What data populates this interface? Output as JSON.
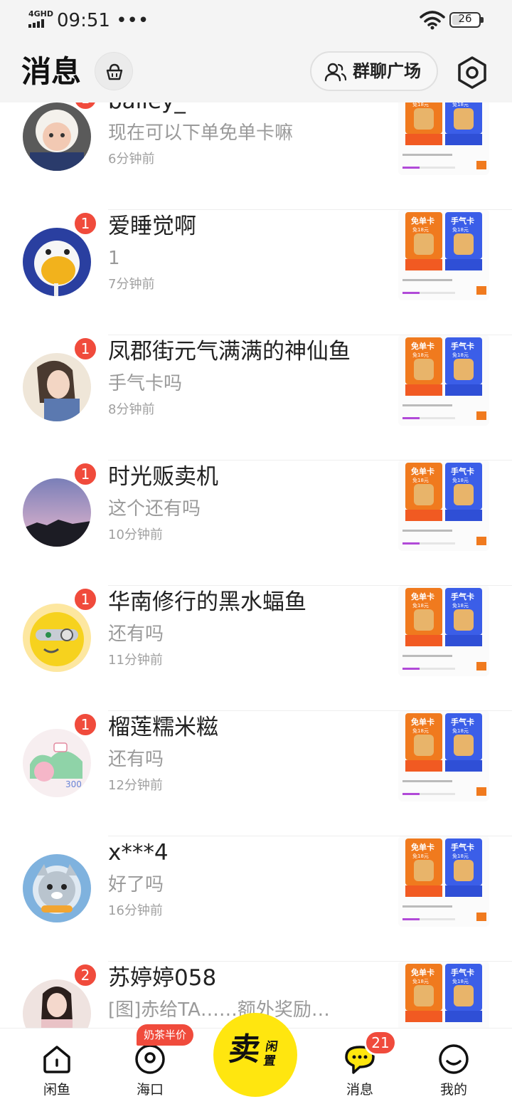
{
  "status_bar": {
    "network": "4GHD",
    "time": "09:51 •••",
    "battery": "26"
  },
  "header": {
    "title": "消息",
    "group_chat_label": "群聊广场"
  },
  "conversations": [
    {
      "name": "bailey_",
      "message": "现在可以下单免单卡嘛",
      "time": "6分钟前",
      "unread": "1"
    },
    {
      "name": "爱睡觉啊",
      "message": "1",
      "time": "7分钟前",
      "unread": "1"
    },
    {
      "name": "凤郡街元气满满的神仙鱼",
      "message": "手气卡吗",
      "time": "8分钟前",
      "unread": "1"
    },
    {
      "name": "时光贩卖机",
      "message": "这个还有吗",
      "time": "10分钟前",
      "unread": "1"
    },
    {
      "name": "华南修行的黑水蝠鱼",
      "message": "还有吗",
      "time": "11分钟前",
      "unread": "1"
    },
    {
      "name": "榴莲糯米糍",
      "message": "还有吗",
      "time": "12分钟前",
      "unread": "1"
    },
    {
      "name": "x***4",
      "message": "好了吗",
      "time": "16分钟前",
      "unread": ""
    },
    {
      "name": "苏婷婷058",
      "message": "[图]赤给TA……额外奖励…",
      "time": "",
      "unread": "2"
    }
  ],
  "thumbnail": {
    "card_left": "免单卡",
    "card_right": "手气卡",
    "price": "免18元"
  },
  "tab_bar": {
    "tabs": [
      {
        "label": "闲鱼",
        "icon": "home-icon"
      },
      {
        "label": "海口",
        "icon": "location-icon"
      },
      {
        "label": "消息",
        "icon": "message-icon"
      },
      {
        "label": "我的",
        "icon": "profile-icon"
      }
    ],
    "promo_tag": "奶茶半价",
    "sell_main": "卖",
    "sell_sub": "闲置",
    "message_count": "21"
  },
  "colors": {
    "badge": "#f04b3c",
    "sell_button": "#ffe60f",
    "background": "#f4f4f4"
  }
}
